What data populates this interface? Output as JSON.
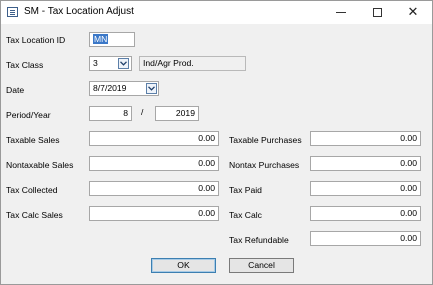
{
  "window": {
    "title": "SM - Tax Location Adjust",
    "icon": "window-list-icon",
    "controls": {
      "minimize": "minimize-icon",
      "maximize": "maximize-icon",
      "close_glyph": "✕"
    }
  },
  "form": {
    "tax_location_id": {
      "label": "Tax Location ID",
      "value": "MN"
    },
    "tax_class": {
      "label": "Tax Class",
      "value": "3",
      "description": "Ind/Agr Prod."
    },
    "date": {
      "label": "Date",
      "value": "8/7/2019"
    },
    "period_year": {
      "label": "Period/Year",
      "period": "8",
      "separator": "/",
      "year": "2019"
    },
    "left_fields": [
      {
        "label": "Taxable Sales",
        "value": "0.00"
      },
      {
        "label": "Nontaxable Sales",
        "value": "0.00"
      },
      {
        "label": "Tax Collected",
        "value": "0.00"
      },
      {
        "label": "Tax Calc Sales",
        "value": "0.00"
      }
    ],
    "right_fields": [
      {
        "label": "Taxable Purchases",
        "value": "0.00"
      },
      {
        "label": "Nontax Purchases",
        "value": "0.00"
      },
      {
        "label": "Tax Paid",
        "value": "0.00"
      },
      {
        "label": "Tax Calc",
        "value": "0.00"
      },
      {
        "label": "Tax Refundable",
        "value": "0.00"
      }
    ]
  },
  "buttons": {
    "ok": "OK",
    "cancel": "Cancel"
  },
  "colors": {
    "selection": "#3b78c8",
    "window_bg": "#f0f0f0",
    "default_button_border": "#3c7fb1"
  }
}
